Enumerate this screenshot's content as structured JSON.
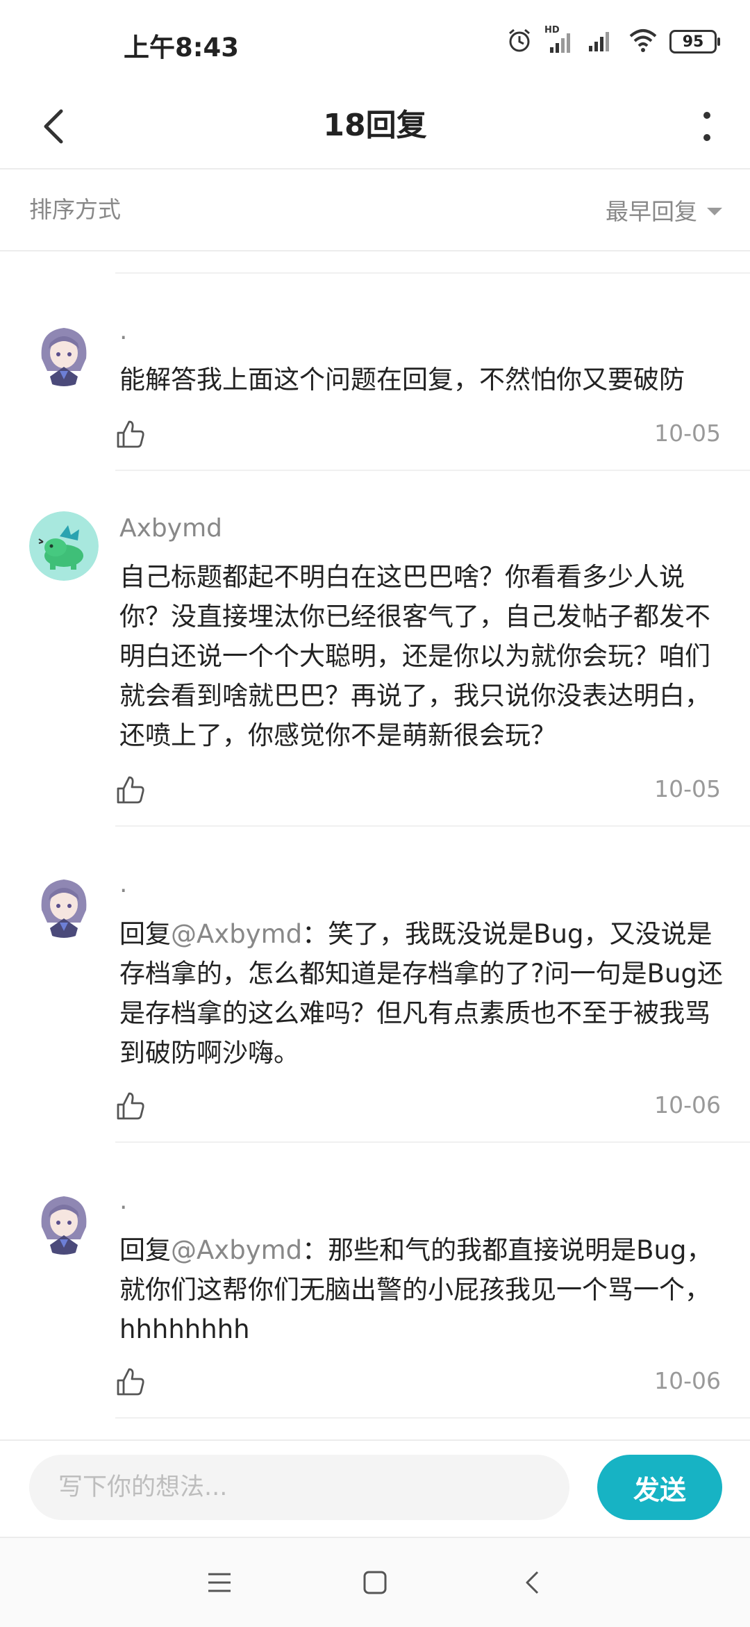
{
  "status_bar": {
    "time": "上午8:43",
    "network_badge": "HD",
    "battery": "95",
    "icons": [
      "alarm-icon",
      "hd-signal-icon",
      "signal-icon",
      "wifi-icon",
      "battery-icon"
    ]
  },
  "header": {
    "title": "18回复",
    "back_icon": "chevron-left-icon",
    "more_icon": "more-vertical-icon"
  },
  "sort": {
    "label": "排序方式",
    "selected": "最早回复"
  },
  "replies": [
    {
      "name": ".",
      "avatar": "anime-girl-avatar",
      "text": "能解答我上面这个问题在回复，不然怕你又要破防",
      "date": "10-05"
    },
    {
      "name": "Axbymd",
      "avatar": "green-dragon-avatar",
      "text": "自己标题都起不明白在这巴巴啥？你看看多少人说你？没直接埋汰你已经很客气了，自己发帖子都发不明白还说一个个大聪明，还是你以为就你会玩？咱们就会看到啥就巴巴？再说了，我只说你没表达明白，还喷上了，你感觉你不是萌新很会玩？",
      "date": "10-05"
    },
    {
      "name": ".",
      "avatar": "anime-girl-avatar",
      "reply_prefix": "回复",
      "mention": "@Axbymd",
      "text": "：笑了，我既没说是Bug，又没说是存档拿的，怎么都知道是存档拿的了?问一句是Bug还是存档拿的这么难吗？但凡有点素质也不至于被我骂到破防啊沙嗨。",
      "date": "10-06"
    },
    {
      "name": ".",
      "avatar": "anime-girl-avatar",
      "reply_prefix": "回复",
      "mention": "@Axbymd",
      "text": "：那些和气的我都直接说明是Bug，就你们这帮你们无脑出警的小屁孩我见一个骂一个，hhhhhhhh",
      "date": "10-06"
    }
  ],
  "composer": {
    "placeholder": "写下你的想法...",
    "value": "",
    "send_label": "发送"
  },
  "colors": {
    "accent": "#17b3c4",
    "muted_text": "#888888",
    "divider": "#f0f0f0"
  },
  "nav": {
    "icons": [
      "menu-icon",
      "home-square-icon",
      "back-triangle-icon"
    ]
  }
}
